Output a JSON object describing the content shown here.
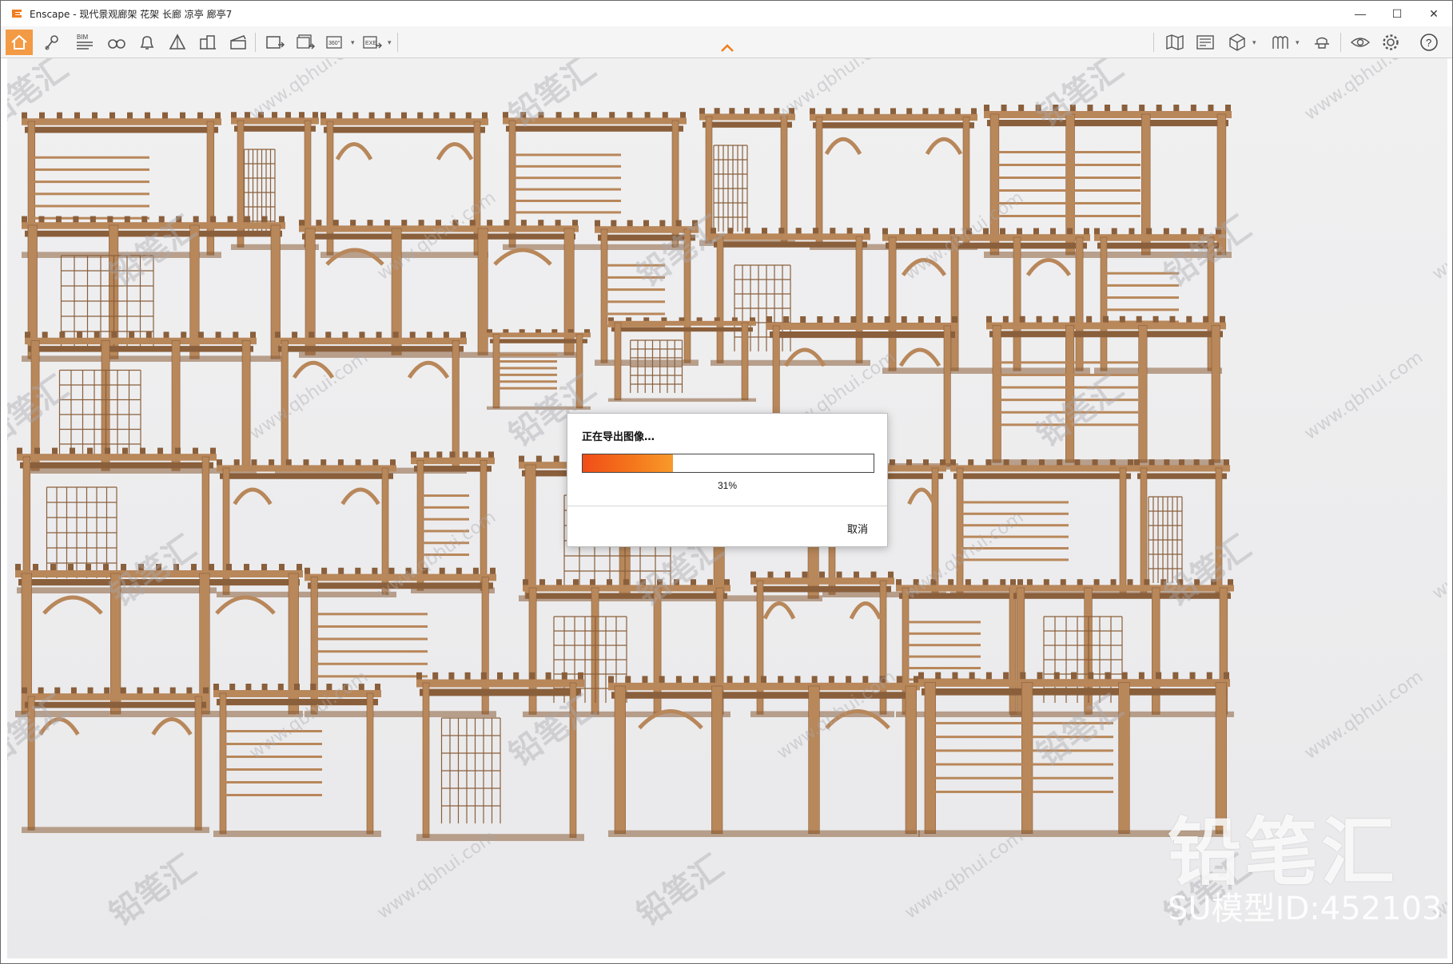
{
  "window": {
    "title": "Enscape - 现代景观廊架 花架 长廊 凉亭 廊亭7",
    "controls": {
      "minimize": "—",
      "maximize": "☐",
      "close": "✕"
    }
  },
  "toolbar": {
    "left_icons": [
      "home-icon",
      "location-pin-icon",
      "bim-icon",
      "binoculars-icon",
      "bell-icon",
      "shape-icon",
      "buildings-icon",
      "clapper-icon",
      "export-image-icon",
      "batch-export-icon",
      "export-360-icon",
      "export-exe-icon"
    ],
    "bim_label": "BIM",
    "pano_label": "360°",
    "exe_label": "EXE",
    "right_icons": [
      "map-icon",
      "asset-library-icon",
      "cube-icon",
      "columns-icon",
      "hat-icon",
      "eye-icon",
      "settings-icon",
      "help-icon"
    ],
    "help_label": "?"
  },
  "colors": {
    "accent": "#f39a44",
    "wood": "#b8875a",
    "wood_dark": "#8a5f3b",
    "progress_start": "#f04d18",
    "progress_end": "#f89a2a"
  },
  "watermarks": {
    "brand": "铅笔汇",
    "url": "www.qbhui.com"
  },
  "brand_overlay": {
    "logo_text": "铅笔汇",
    "model_id": "SU模型ID:452103"
  },
  "dialog": {
    "title": "正在导出图像…",
    "progress": 0.31,
    "progress_label": "31%",
    "cancel_label": "取消"
  }
}
